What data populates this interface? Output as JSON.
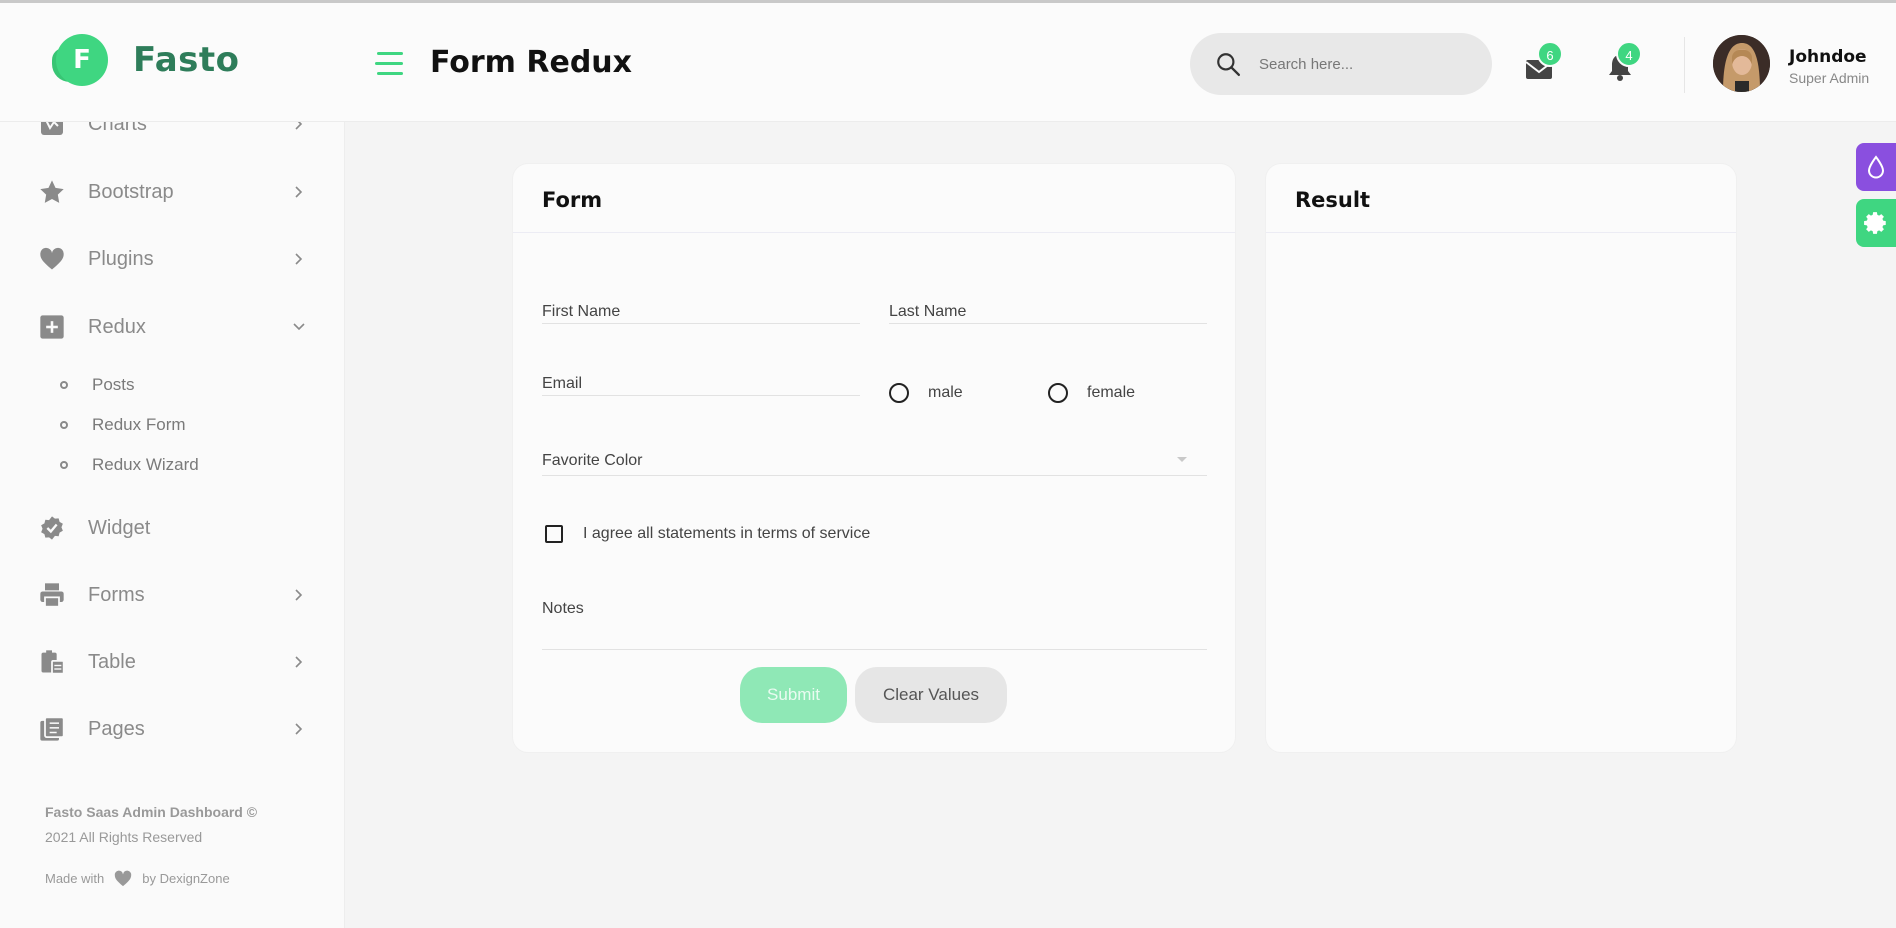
{
  "brand": {
    "name": "Fasto",
    "mark": "F"
  },
  "header": {
    "title": "Form Redux",
    "search_placeholder": "Search here...",
    "mail_count": "6",
    "notification_count": "4",
    "user": {
      "name": "Johndoe",
      "role": "Super Admin"
    }
  },
  "sidebar": {
    "items": [
      {
        "label": "Charts",
        "icon": "chart-icon"
      },
      {
        "label": "Bootstrap",
        "icon": "star-icon"
      },
      {
        "label": "Plugins",
        "icon": "heart-icon"
      },
      {
        "label": "Redux",
        "icon": "plus-square-icon"
      },
      {
        "label": "Widget",
        "icon": "badge-check-icon"
      },
      {
        "label": "Forms",
        "icon": "printer-icon"
      },
      {
        "label": "Table",
        "icon": "clipboard-table-icon"
      },
      {
        "label": "Pages",
        "icon": "pages-icon"
      }
    ],
    "redux_sub": [
      "Posts",
      "Redux Form",
      "Redux Wizard"
    ],
    "footer": {
      "line1": "Fasto Saas Admin Dashboard ©",
      "line2": "2021 All Rights Reserved",
      "made_with": "Made with",
      "by": "by DexignZone"
    }
  },
  "form_card": {
    "title": "Form",
    "first_name_placeholder": "First Name",
    "last_name_placeholder": "Last Name",
    "email_placeholder": "Email",
    "gender_options": [
      "male",
      "female"
    ],
    "favorite_color_label": "Favorite Color",
    "terms_label": "I agree all statements in terms of service",
    "notes_placeholder": "Notes",
    "submit_label": "Submit",
    "clear_label": "Clear Values"
  },
  "result_card": {
    "title": "Result"
  },
  "colors": {
    "accent": "#3fd681",
    "theme_button": "#8a4fdf"
  }
}
